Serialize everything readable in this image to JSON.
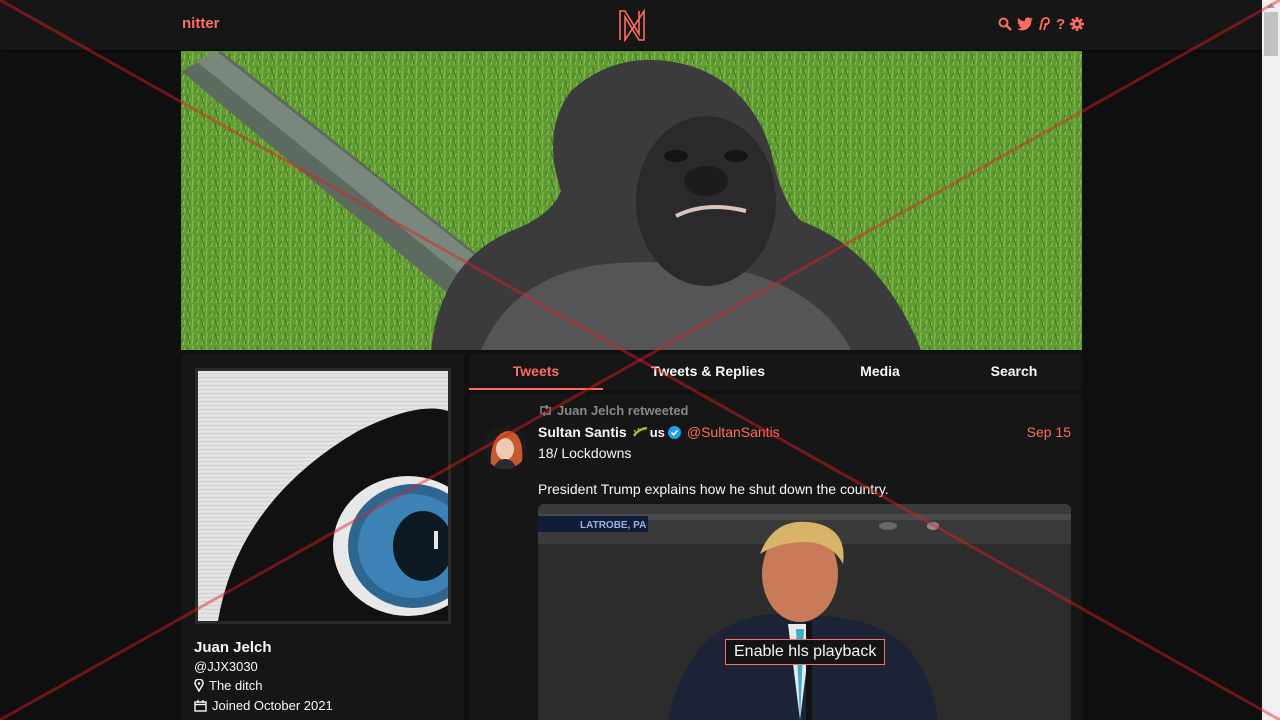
{
  "nav": {
    "brand": "nitter",
    "icons": [
      "search-icon",
      "twitter-icon",
      "rss-icon",
      "help-icon",
      "settings-icon"
    ],
    "help_glyph": "?"
  },
  "colors": {
    "accent": "#ff6c60",
    "background": "#0f0f0f",
    "panel": "#161616",
    "text": "#f8f8f2",
    "muted": "#888889"
  },
  "profile": {
    "fullname": "Juan Jelch",
    "username": "@JJX3030",
    "location": "The ditch",
    "joined": "Joined October 2021"
  },
  "tabs": [
    {
      "label": "Tweets",
      "active": true
    },
    {
      "label": "Tweets & Replies",
      "active": false
    },
    {
      "label": "Media",
      "active": false
    },
    {
      "label": "Search",
      "active": false
    }
  ],
  "tweet": {
    "retweet_header": "Juan Jelch retweeted",
    "fullname": "Sultan Santis",
    "flag_text": "us",
    "username": "@SultanSantis",
    "date": "Sep 15",
    "lines": [
      "18/ Lockdowns",
      "President Trump explains how he shut down the country."
    ],
    "media_caption": "LATROBE, PA",
    "video_button": "Enable hls playback"
  }
}
